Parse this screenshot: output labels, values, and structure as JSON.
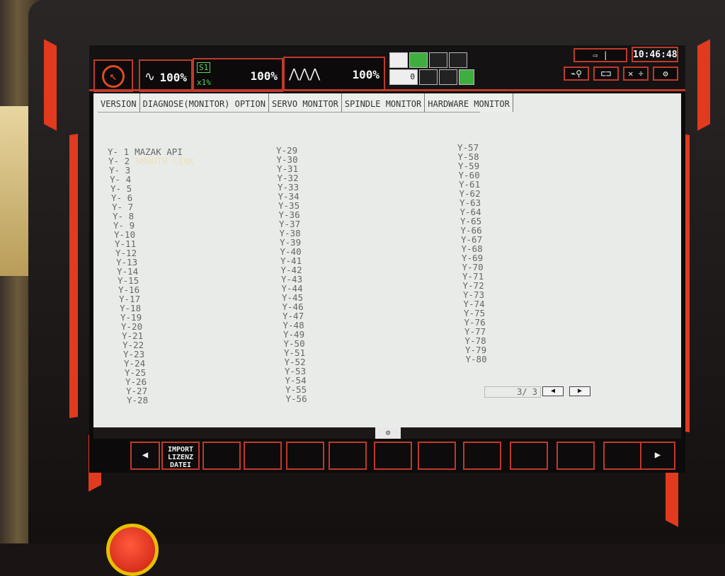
{
  "header": {
    "overrides": [
      {
        "wave": "∿",
        "percent": "100%"
      },
      {
        "wave": "",
        "percent": "100%",
        "badge_top": "S1",
        "badge_bottom": "x1%"
      },
      {
        "wave": "⋀⋀⋀",
        "percent": "100%"
      }
    ],
    "clock": "10:46:48",
    "counter": "0",
    "mini_buttons": [
      "⇨ |",
      "⌁⚲",
      "⊏⊐",
      "✕ ÷",
      "⚙"
    ]
  },
  "tabs": [
    "VERSION",
    "DIAGNOSE(MONITOR) OPTION",
    "SERVO MONITOR",
    "SPINDLE MONITOR",
    "HARDWARE MONITOR"
  ],
  "columns": [
    {
      "rows": [
        {
          "label": "Y- 1",
          "value": "MAZAK API"
        },
        {
          "label": "Y- 2",
          "value": "SMOOTH LINK"
        },
        {
          "label": "Y- 3",
          "value": ""
        },
        {
          "label": "Y- 4",
          "value": ""
        },
        {
          "label": "Y- 5",
          "value": ""
        },
        {
          "label": "Y- 6",
          "value": ""
        },
        {
          "label": "Y- 7",
          "value": ""
        },
        {
          "label": "Y- 8",
          "value": ""
        },
        {
          "label": "Y- 9",
          "value": ""
        },
        {
          "label": "Y-10",
          "value": ""
        },
        {
          "label": "Y-11",
          "value": ""
        },
        {
          "label": "Y-12",
          "value": ""
        },
        {
          "label": "Y-13",
          "value": ""
        },
        {
          "label": "Y-14",
          "value": ""
        },
        {
          "label": "Y-15",
          "value": ""
        },
        {
          "label": "Y-16",
          "value": ""
        },
        {
          "label": "Y-17",
          "value": ""
        },
        {
          "label": "Y-18",
          "value": ""
        },
        {
          "label": "Y-19",
          "value": ""
        },
        {
          "label": "Y-20",
          "value": ""
        },
        {
          "label": "Y-21",
          "value": ""
        },
        {
          "label": "Y-22",
          "value": ""
        },
        {
          "label": "Y-23",
          "value": ""
        },
        {
          "label": "Y-24",
          "value": ""
        },
        {
          "label": "Y-25",
          "value": ""
        },
        {
          "label": "Y-26",
          "value": ""
        },
        {
          "label": "Y-27",
          "value": ""
        },
        {
          "label": "Y-28",
          "value": ""
        }
      ]
    },
    {
      "rows": [
        {
          "label": "Y-29"
        },
        {
          "label": "Y-30"
        },
        {
          "label": "Y-31"
        },
        {
          "label": "Y-32"
        },
        {
          "label": "Y-33"
        },
        {
          "label": "Y-34"
        },
        {
          "label": "Y-35"
        },
        {
          "label": "Y-36"
        },
        {
          "label": "Y-37"
        },
        {
          "label": "Y-38"
        },
        {
          "label": "Y-39"
        },
        {
          "label": "Y-40"
        },
        {
          "label": "Y-41"
        },
        {
          "label": "Y-42"
        },
        {
          "label": "Y-43"
        },
        {
          "label": "Y-44"
        },
        {
          "label": "Y-45"
        },
        {
          "label": "Y-46"
        },
        {
          "label": "Y-47"
        },
        {
          "label": "Y-48"
        },
        {
          "label": "Y-49"
        },
        {
          "label": "Y-50"
        },
        {
          "label": "Y-51"
        },
        {
          "label": "Y-52"
        },
        {
          "label": "Y-53"
        },
        {
          "label": "Y-54"
        },
        {
          "label": "Y-55"
        },
        {
          "label": "Y-56"
        }
      ]
    },
    {
      "rows": [
        {
          "label": "Y-57"
        },
        {
          "label": "Y-58"
        },
        {
          "label": "Y-59"
        },
        {
          "label": "Y-60"
        },
        {
          "label": "Y-61"
        },
        {
          "label": "Y-62"
        },
        {
          "label": "Y-63"
        },
        {
          "label": "Y-64"
        },
        {
          "label": "Y-65"
        },
        {
          "label": "Y-66"
        },
        {
          "label": "Y-67"
        },
        {
          "label": "Y-68"
        },
        {
          "label": "Y-69"
        },
        {
          "label": "Y-70"
        },
        {
          "label": "Y-71"
        },
        {
          "label": "Y-72"
        },
        {
          "label": "Y-73"
        },
        {
          "label": "Y-74"
        },
        {
          "label": "Y-75"
        },
        {
          "label": "Y-76"
        },
        {
          "label": "Y-77"
        },
        {
          "label": "Y-78"
        },
        {
          "label": "Y-79"
        },
        {
          "label": "Y-80"
        }
      ]
    }
  ],
  "pager": {
    "text": "3/  3",
    "prev": "◀",
    "next": "▶"
  },
  "scroll_icon": "⊘",
  "softkeys": [
    {
      "label": "◀"
    },
    {
      "label": "IMPORT\nLIZENZ\nDATEI"
    },
    {
      "label": ""
    },
    {
      "label": ""
    },
    {
      "label": ""
    },
    {
      "label": ""
    },
    {
      "label": ""
    },
    {
      "label": ""
    },
    {
      "label": ""
    },
    {
      "label": ""
    },
    {
      "label": ""
    },
    {
      "label": ""
    },
    {
      "label": "▶"
    }
  ],
  "colors": {
    "accent": "#c0392b",
    "screen_bg": "#e9ebe9",
    "text": "#666666",
    "highlight": "#f0e0b0"
  }
}
